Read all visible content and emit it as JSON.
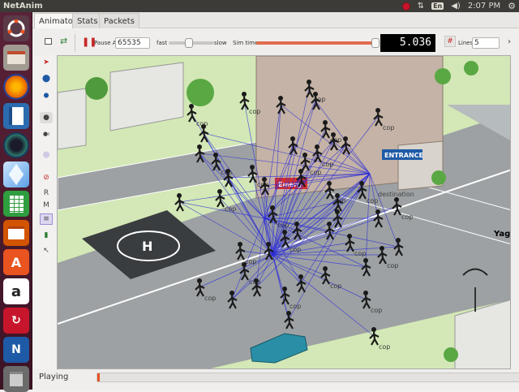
{
  "topbar": {
    "app_title": "NetAnim",
    "keyboard_layout": "En",
    "clock": "2:07 PM"
  },
  "tabs": [
    {
      "label": "Animator"
    },
    {
      "label": "Stats"
    },
    {
      "label": "Packets"
    }
  ],
  "toolbar": {
    "pause_at_label": "Pause At",
    "pause_at_value": "65535",
    "fast_label": "fast",
    "slow_label": "slow",
    "speed_level": 0.45,
    "sim_time_label": "Sim time",
    "sim_time_progress": 0.99,
    "sim_time_value": "5.036",
    "lines_label": "Lines",
    "lines_value": "5"
  },
  "side_tools": {
    "r_label": "R",
    "m_label": "M"
  },
  "canvas": {
    "node_label": "cop",
    "emergency_sign": "Emerg",
    "entrance_sign": "ENTRANCE",
    "destination_label": "destination",
    "antenna_label": "Yagi"
  },
  "status": {
    "label": "Playing",
    "progress": 0.005
  },
  "launcher": [
    "ubuntu-icon",
    "files-icon",
    "firefox-icon",
    "writer-icon",
    "screenshot-icon",
    "software-icon",
    "calc-icon",
    "impress-icon",
    "app-store-icon",
    "amazon-icon",
    "update-icon",
    "netanim-icon"
  ],
  "colors": {
    "accent": "#e95420",
    "launcher_bg": "#4a1a2e",
    "packet_line": "#2a2ad8",
    "lcd_bg": "#000000"
  }
}
